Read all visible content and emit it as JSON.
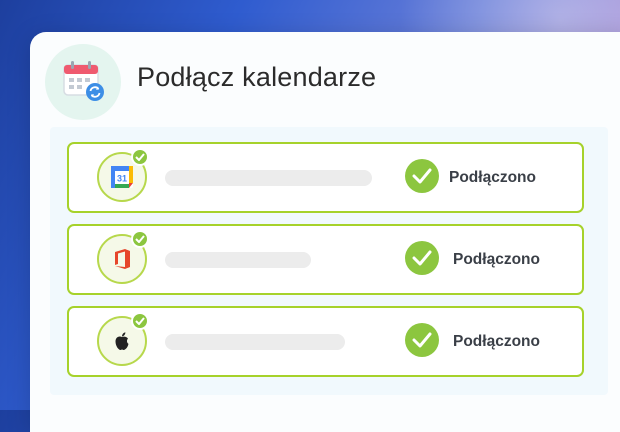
{
  "title": "Podłącz kalendarze",
  "header_icon": "calendar-sync-icon",
  "calendars": [
    {
      "icon": "google-calendar-icon",
      "logo_text": "31",
      "status": "Podłączono",
      "connected": true
    },
    {
      "icon": "office-icon",
      "status": "Podłączono",
      "connected": true
    },
    {
      "icon": "apple-icon",
      "status": "Podłączono",
      "connected": true
    }
  ],
  "colors": {
    "accent_green": "#8cc63f",
    "row_border": "#a6d22b",
    "panel_bg": "#f1f9fd",
    "header_icon_bg": "#e4f5ef"
  }
}
